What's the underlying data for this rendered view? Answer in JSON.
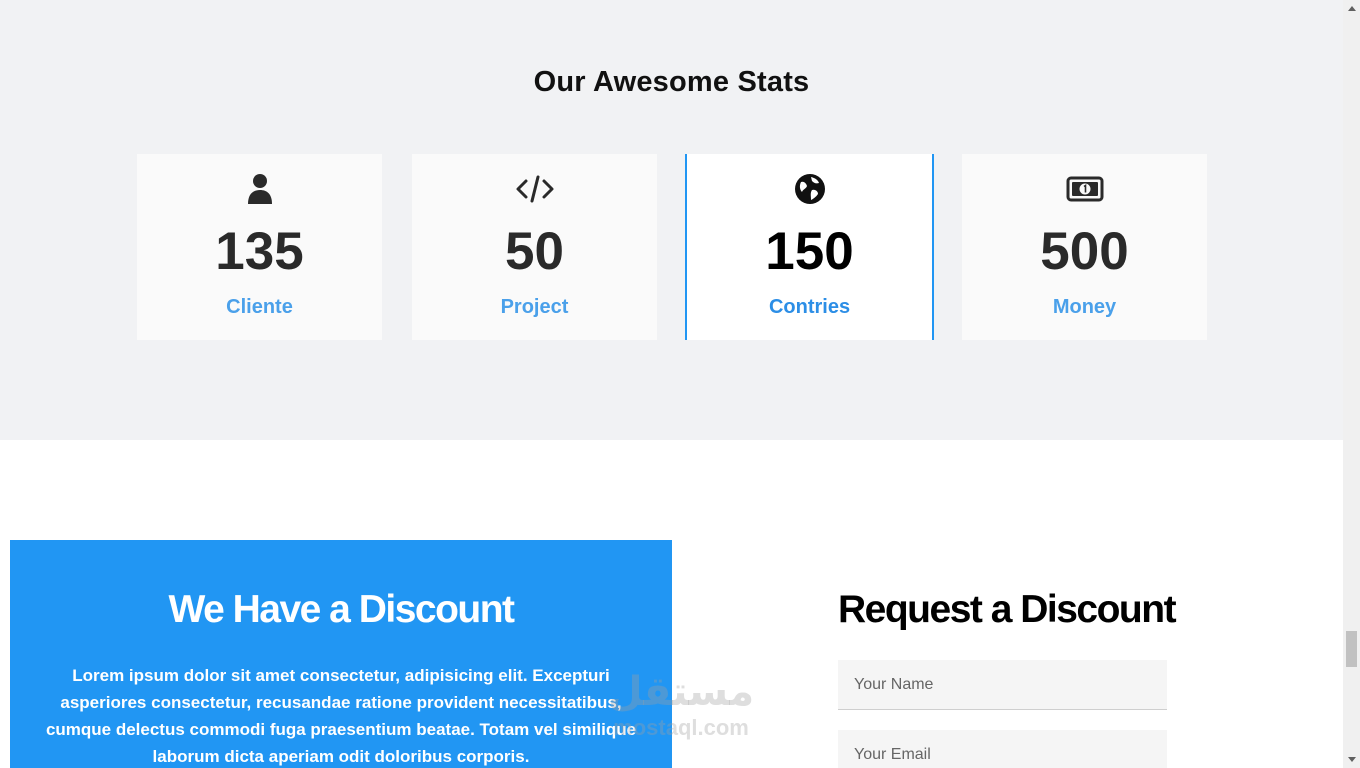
{
  "stats": {
    "title": "Our Awesome Stats",
    "items": [
      {
        "icon": "user-icon",
        "number": "135",
        "label": "Cliente"
      },
      {
        "icon": "code-icon",
        "number": "50",
        "label": "Project"
      },
      {
        "icon": "globe-icon",
        "number": "150",
        "label": "Contries",
        "active": true
      },
      {
        "icon": "money-bill-icon",
        "number": "500",
        "label": "Money"
      }
    ]
  },
  "discount": {
    "title": "We Have a Discount",
    "text": "Lorem ipsum dolor sit amet consectetur, adipisicing elit. Excepturi asperiores consectetur, recusandae ratione provident necessitatibus, cumque delectus commodi fuga praesentium beatae. Totam vel similique laborum dicta aperiam odit doloribus corporis."
  },
  "request": {
    "title": "Request a Discount",
    "name_placeholder": "Your Name",
    "email_placeholder": "Your Email"
  },
  "watermark": {
    "arabic": "مستقل",
    "latin": "mostaql.com"
  },
  "colors": {
    "accent": "#2196f3",
    "stats_bg": "#f1f2f4",
    "label": "#4aa0ea"
  },
  "scrollbar": {
    "position": 0.88,
    "visible_fraction": 0.05
  }
}
